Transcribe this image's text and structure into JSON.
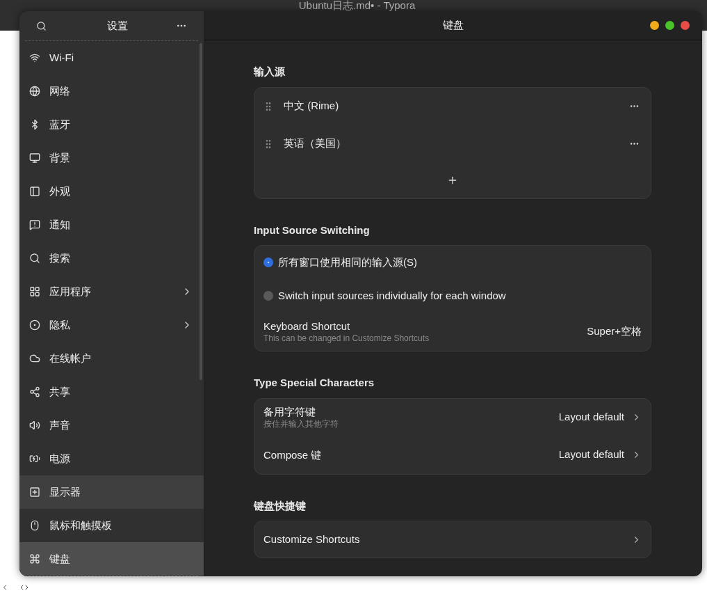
{
  "background_window": {
    "title": "Ubuntu日志.md• - Typora"
  },
  "sidebar": {
    "title": "设置",
    "items": [
      {
        "label": "Wi-Fi",
        "selected": false,
        "hovered": false,
        "has_submenu": false
      },
      {
        "label": "网络",
        "selected": false,
        "hovered": false,
        "has_submenu": false
      },
      {
        "label": "蓝牙",
        "selected": false,
        "hovered": false,
        "has_submenu": false
      },
      {
        "label": "背景",
        "selected": false,
        "hovered": false,
        "has_submenu": false
      },
      {
        "label": "外观",
        "selected": false,
        "hovered": false,
        "has_submenu": false
      },
      {
        "label": "通知",
        "selected": false,
        "hovered": false,
        "has_submenu": false
      },
      {
        "label": "搜索",
        "selected": false,
        "hovered": false,
        "has_submenu": false
      },
      {
        "label": "应用程序",
        "selected": false,
        "hovered": false,
        "has_submenu": true
      },
      {
        "label": "隐私",
        "selected": false,
        "hovered": false,
        "has_submenu": true
      },
      {
        "label": "在线帐户",
        "selected": false,
        "hovered": false,
        "has_submenu": false
      },
      {
        "label": "共享",
        "selected": false,
        "hovered": false,
        "has_submenu": false
      },
      {
        "label": "声音",
        "selected": false,
        "hovered": false,
        "has_submenu": false
      },
      {
        "label": "电源",
        "selected": false,
        "hovered": false,
        "has_submenu": false
      },
      {
        "label": "显示器",
        "selected": false,
        "hovered": true,
        "has_submenu": false
      },
      {
        "label": "鼠标和触摸板",
        "selected": false,
        "hovered": false,
        "has_submenu": false
      },
      {
        "label": "键盘",
        "selected": true,
        "hovered": false,
        "has_submenu": false
      }
    ]
  },
  "page": {
    "title": "键盘",
    "input_sources": {
      "heading": "输入源",
      "items": [
        {
          "label": "中文 (Rime)"
        },
        {
          "label": "英语（美国）"
        }
      ]
    },
    "switching": {
      "heading": "Input Source Switching",
      "options": [
        {
          "label": "所有窗口使用相同的输入源(S)",
          "selected": true
        },
        {
          "label": "Switch input sources individually for each window",
          "selected": false
        }
      ],
      "shortcut": {
        "label": "Keyboard Shortcut",
        "hint": "This can be changed in Customize Shortcuts",
        "value": "Super+空格"
      }
    },
    "special": {
      "heading": "Type Special Characters",
      "rows": [
        {
          "label": "备用字符键",
          "hint": "按住并输入其他字符",
          "value": "Layout default"
        },
        {
          "label": "Compose 键",
          "value": "Layout default"
        }
      ]
    },
    "shortcuts": {
      "heading": "键盘快捷键",
      "rows": [
        {
          "label": "Customize Shortcuts"
        }
      ]
    }
  }
}
